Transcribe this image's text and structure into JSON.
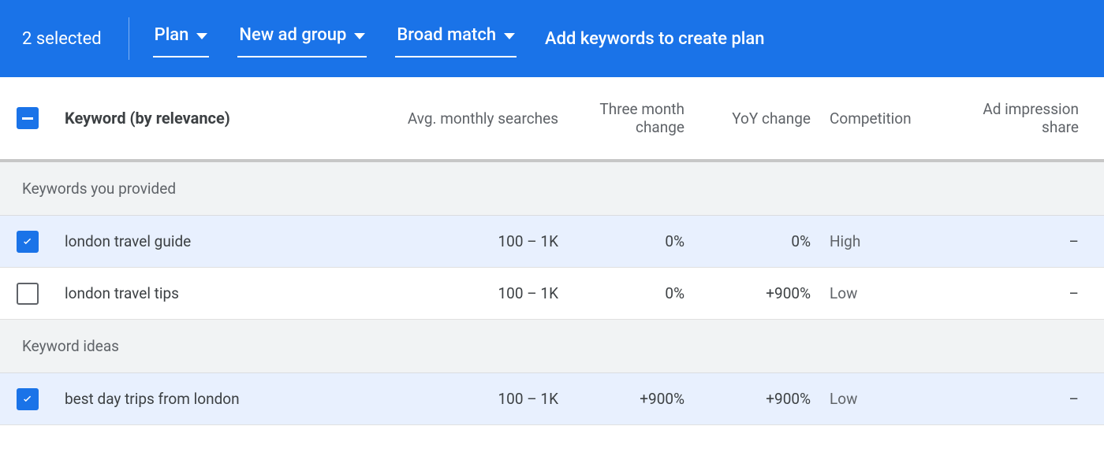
{
  "actionBar": {
    "selectedText": "2 selected",
    "planLabel": "Plan",
    "adGroupLabel": "New ad group",
    "matchLabel": "Broad match",
    "promptText": "Add keywords to create plan"
  },
  "headers": {
    "keyword": "Keyword (by relevance)",
    "avgSearches": "Avg. monthly searches",
    "threeMonth": "Three month change",
    "yoy": "YoY change",
    "competition": "Competition",
    "adShare": "Ad impression share"
  },
  "sections": {
    "provided": "Keywords you provided",
    "ideas": "Keyword ideas"
  },
  "rows": {
    "r1": {
      "keyword": "london travel guide",
      "avg": "100 – 1K",
      "threeMonth": "0%",
      "yoy": "0%",
      "competition": "High",
      "adShare": "–",
      "checked": true
    },
    "r2": {
      "keyword": "london travel tips",
      "avg": "100 – 1K",
      "threeMonth": "0%",
      "yoy": "+900%",
      "competition": "Low",
      "adShare": "–",
      "checked": false
    },
    "r3": {
      "keyword": "best day trips from london",
      "avg": "100 – 1K",
      "threeMonth": "+900%",
      "yoy": "+900%",
      "competition": "Low",
      "adShare": "–",
      "checked": true
    }
  }
}
